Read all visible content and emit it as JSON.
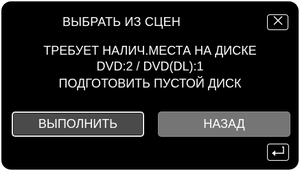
{
  "dialog": {
    "title": "ВЫБРАТЬ ИЗ СЦЕН",
    "message_lines": [
      "ТРЕБУЕТ НАЛИЧ.МЕСТА НА ДИСКЕ",
      "DVD:2 / DVD(DL):1",
      "ПОДГОТОВИТЬ ПУСТОЙ ДИСК"
    ],
    "close_icon": "close-x-icon",
    "return_icon": "return-arrow-icon"
  },
  "buttons": {
    "execute_label": "ВЫПОЛНИТЬ",
    "back_label": "НАЗАД"
  },
  "colors": {
    "background": "#000000",
    "text": "#ffffff",
    "execute_button": "#4a4a4a",
    "back_button": "#757575"
  }
}
